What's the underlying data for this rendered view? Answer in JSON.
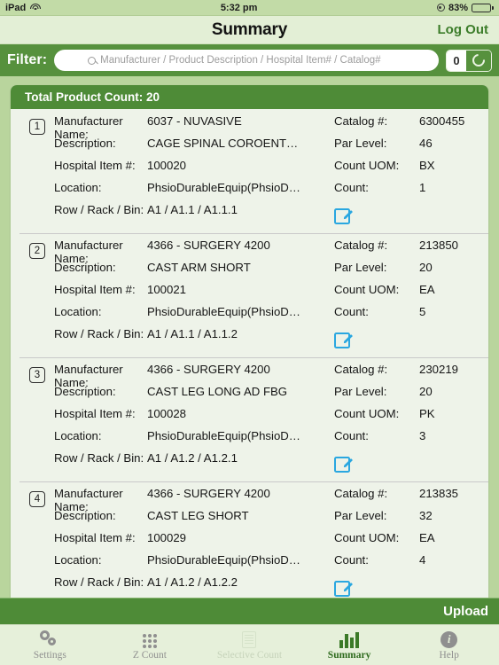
{
  "statusbar": {
    "device": "iPad",
    "wifi_icon": "wifi-icon",
    "time": "5:32 pm",
    "lock_icon": "rotation-lock-icon",
    "battery_percent": "83%"
  },
  "navbar": {
    "title": "Summary",
    "logout_label": "Log Out"
  },
  "filterbar": {
    "label": "Filter:",
    "search_icon": "search-icon",
    "placeholder": "Manufacturer / Product Description / Hospital Item# / Catalog#",
    "search_value": "",
    "count_badge": "0",
    "refresh_icon": "refresh-icon"
  },
  "list": {
    "header": "Total Product Count: 20",
    "labels": {
      "manufacturer": "Manufacturer Name:",
      "description": "Description:",
      "hospital_item": "Hospital Item #:",
      "location": "Location:",
      "row_rack_bin": "Row / Rack / Bin:",
      "catalog": "Catalog #:",
      "par_level": "Par Level:",
      "count_uom": "Count UOM:",
      "count": "Count:"
    },
    "items": [
      {
        "index": "1",
        "manufacturer": "6037 - NUVASIVE",
        "description": "CAGE SPINAL COROENT…",
        "hospital_item": "100020",
        "location": "PhsioDurableEquip(PhsioD…",
        "row_rack_bin": "A1 / A1.1 / A1.1.1",
        "catalog": "6300455",
        "par_level": "46",
        "count_uom": "BX",
        "count": "1",
        "edit_icon": "edit-icon"
      },
      {
        "index": "2",
        "manufacturer": "4366 - SURGERY 4200",
        "description": "CAST ARM SHORT",
        "hospital_item": "100021",
        "location": "PhsioDurableEquip(PhsioD…",
        "row_rack_bin": "A1 / A1.1 / A1.1.2",
        "catalog": "213850",
        "par_level": "20",
        "count_uom": "EA",
        "count": "5",
        "edit_icon": "edit-icon"
      },
      {
        "index": "3",
        "manufacturer": "4366 - SURGERY 4200",
        "description": "CAST LEG LONG AD FBG",
        "hospital_item": "100028",
        "location": "PhsioDurableEquip(PhsioD…",
        "row_rack_bin": "A1 / A1.2 / A1.2.1",
        "catalog": "230219",
        "par_level": "20",
        "count_uom": "PK",
        "count": "3",
        "edit_icon": "edit-icon"
      },
      {
        "index": "4",
        "manufacturer": "4366 - SURGERY 4200",
        "description": "CAST LEG SHORT",
        "hospital_item": "100029",
        "location": "PhsioDurableEquip(PhsioD…",
        "row_rack_bin": "A1 / A1.2 / A1.2.2",
        "catalog": "213835",
        "par_level": "32",
        "count_uom": "EA",
        "count": "4",
        "edit_icon": "edit-icon"
      }
    ]
  },
  "uploadbar": {
    "label": "Upload"
  },
  "tabbar": {
    "tabs": [
      {
        "label": "Settings",
        "icon": "gears-icon",
        "state": ""
      },
      {
        "label": "Z Count",
        "icon": "grid-dots-icon",
        "state": ""
      },
      {
        "label": "Selective Count",
        "icon": "list-document-icon",
        "state": "disabled"
      },
      {
        "label": "Summary",
        "icon": "bar-chart-icon",
        "state": "active"
      },
      {
        "label": "Help",
        "icon": "info-icon",
        "state": ""
      }
    ]
  },
  "colors": {
    "page_bg": "#b9d59d",
    "header_green": "#4e8b37",
    "filter_green": "#56913d",
    "nav_bg": "#e3efd6",
    "card_bg": "#eef3e9",
    "accent_blue": "#2aa7e0",
    "tab_active": "#2f6b1e"
  }
}
